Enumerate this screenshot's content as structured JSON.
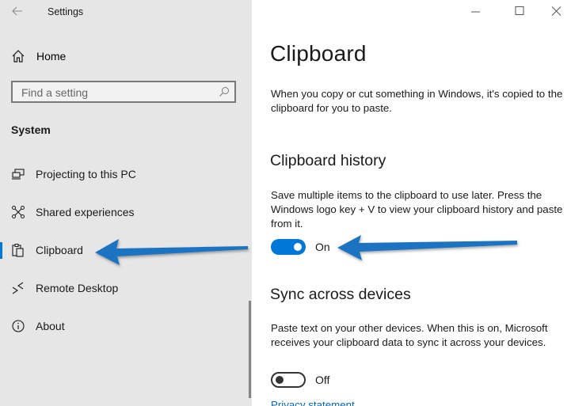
{
  "window": {
    "title": "Settings",
    "controls": [
      "minimize",
      "maximize",
      "close"
    ]
  },
  "sidebar": {
    "home_label": "Home",
    "search": {
      "placeholder": "Find a setting",
      "value": ""
    },
    "section_label": "System",
    "items": [
      {
        "label": "Projecting to this PC",
        "icon": "projector-icon",
        "active": false
      },
      {
        "label": "Shared experiences",
        "icon": "shared-experiences-icon",
        "active": false
      },
      {
        "label": "Clipboard",
        "icon": "clipboard-icon",
        "active": true
      },
      {
        "label": "Remote Desktop",
        "icon": "remote-desktop-icon",
        "active": false
      },
      {
        "label": "About",
        "icon": "info-icon",
        "active": false
      }
    ]
  },
  "main": {
    "title": "Clipboard",
    "intro": "When you copy or cut something in Windows, it's copied to the clipboard for you to paste.",
    "sections": [
      {
        "heading": "Clipboard history",
        "description": "Save multiple items to the clipboard to use later. Press the Windows logo key + V to view your clipboard history and paste from it.",
        "toggle_state": "On",
        "toggle_on": true
      },
      {
        "heading": "Sync across devices",
        "description": "Paste text on your other devices. When this is on, Microsoft receives your clipboard data to sync it across your devices.",
        "toggle_state": "Off",
        "toggle_on": false
      }
    ],
    "footer_link": "Privacy statement"
  },
  "annotations": {
    "arrow_color": "#1a73c2",
    "arrows": [
      "points-to-clipboard-nav",
      "points-to-clipboard-history-toggle"
    ]
  },
  "colors": {
    "accent": "#0078d7",
    "sidebar_bg": "#e6e6e6",
    "main_bg": "#ffffff"
  }
}
